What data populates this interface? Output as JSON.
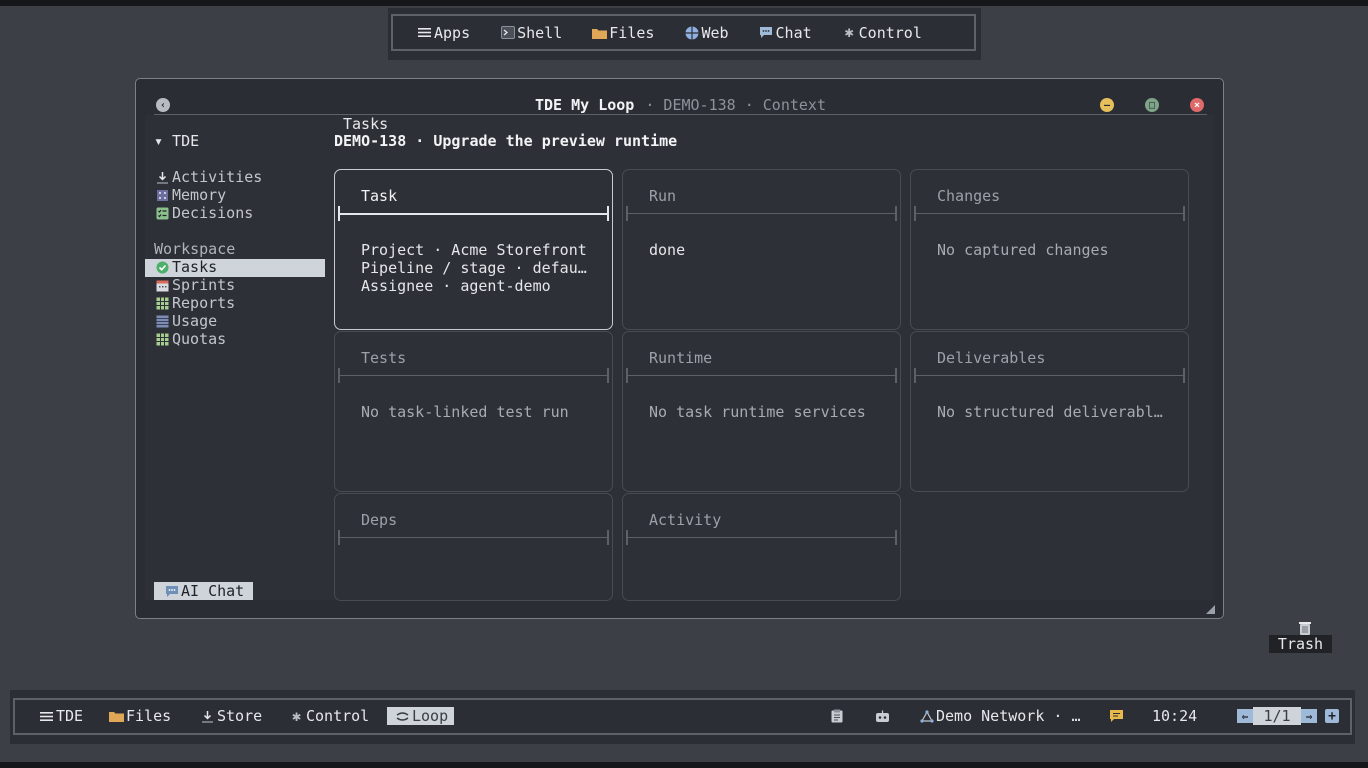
{
  "top_bar": {
    "items": [
      {
        "label": "Apps",
        "icon": "menu-icon"
      },
      {
        "label": "Shell",
        "icon": "terminal-icon"
      },
      {
        "label": "Files",
        "icon": "folder-icon"
      },
      {
        "label": "Web",
        "icon": "globe-icon"
      },
      {
        "label": "Chat",
        "icon": "chat-icon"
      },
      {
        "label": "Control",
        "icon": "gear-icon"
      }
    ]
  },
  "window": {
    "title": "TDE My Loop",
    "subtitle": " · DEMO-138 · Context",
    "controls": [
      "back",
      "minimize",
      "maximize",
      "close"
    ],
    "colors": {
      "minimize": "#e7c05b",
      "maximize": "#7fa589",
      "close": "#e06a6a"
    }
  },
  "sidebar": {
    "root": "▾ TDE",
    "items": [
      {
        "label": "Activities",
        "icon": "download-icon"
      },
      {
        "label": "Memory",
        "icon": "memory-icon"
      },
      {
        "label": "Decisions",
        "icon": "checklist-icon"
      }
    ],
    "section": "Workspace",
    "workspace_items": [
      {
        "label": "Tasks",
        "icon": "check-circle-icon",
        "active": true
      },
      {
        "label": "Sprints",
        "icon": "calendar-icon"
      },
      {
        "label": "Reports",
        "icon": "grid-icon"
      },
      {
        "label": "Usage",
        "icon": "bars-icon"
      },
      {
        "label": "Quotas",
        "icon": "grid-icon"
      }
    ],
    "ai_chat": "AI Chat"
  },
  "main": {
    "tab": "Tasks",
    "heading": "DEMO-138 · Upgrade the preview runtime",
    "cards": {
      "task": {
        "title": "Task",
        "lines": [
          "Project · Acme Storefront",
          "Pipeline / stage · defau…",
          "Assignee · agent-demo"
        ]
      },
      "run": {
        "title": "Run",
        "lines": [
          "done"
        ]
      },
      "changes": {
        "title": "Changes",
        "lines": [
          "No captured changes"
        ]
      },
      "tests": {
        "title": "Tests",
        "lines": [
          "No task-linked test run"
        ]
      },
      "runtime": {
        "title": "Runtime",
        "lines": [
          "No task runtime services"
        ]
      },
      "deliverables": {
        "title": "Deliverables",
        "lines": [
          "No structured deliverabl…"
        ]
      },
      "deps": {
        "title": "Deps",
        "lines": []
      },
      "activity": {
        "title": "Activity",
        "lines": []
      }
    }
  },
  "desktop": {
    "trash_label": "Trash"
  },
  "taskbar": {
    "items": [
      {
        "label": "TDE",
        "icon": "menu-icon"
      },
      {
        "label": "Files",
        "icon": "folder-icon"
      },
      {
        "label": "Store",
        "icon": "download-icon"
      },
      {
        "label": "Control",
        "icon": "gear-icon"
      },
      {
        "label": "Loop",
        "icon": "loop-icon",
        "active": true
      }
    ],
    "network": "Demo Network · …",
    "clock": "10:24",
    "pager": "1/1"
  }
}
